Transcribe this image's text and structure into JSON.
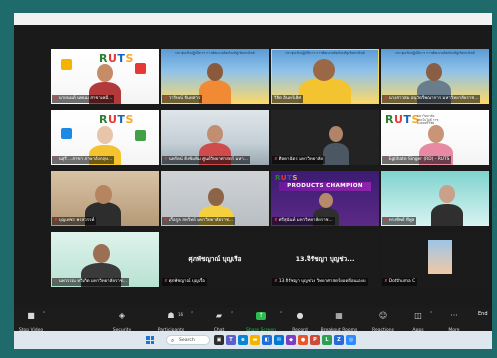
{
  "meeting": {
    "app": "Zoom",
    "tiles": [
      {
        "name": "นายนนท์ นพนม สาขาเคมี...",
        "row": 0,
        "col": 0,
        "bg": "bg-rut",
        "muted": true
      },
      {
        "name": "วาริษณ์ จันทสาร",
        "row": 0,
        "col": 1,
        "bg": "bg-banner",
        "muted": true
      },
      {
        "name": "วิจิต อินทร์เลิศ",
        "row": 0,
        "col": 2,
        "bg": "bg-banner",
        "muted": false,
        "active": true
      },
      {
        "name": "นางสาวสม อนุวัตรีพณาการ มหาวิทยาลัยราช...",
        "row": 0,
        "col": 3,
        "bg": "bg-banner",
        "muted": true
      },
      {
        "name": "นสุรี ...สาขา ภาษาอังกฤษ...",
        "row": 1,
        "col": 0,
        "bg": "bg-rut",
        "muted": true
      },
      {
        "name": "นพรัตน์ ดิ่งพิมพิม ศูนย์วิทยาศาสตร์ มหา...",
        "row": 1,
        "col": 1,
        "bg": "bg-office",
        "muted": true
      },
      {
        "name": "ศิลดาฉัตร มหาวิทยาลัย",
        "row": 1,
        "col": 2,
        "bg": "bg-dark",
        "muted": true
      },
      {
        "name": "Eglihate Singer (RD) - RUTS",
        "row": 1,
        "col": 3,
        "bg": "bg-rut",
        "muted": true
      },
      {
        "name": "บุญเพชร พรสวรรค์",
        "row": 2,
        "col": 0,
        "bg": "bg-wood",
        "muted": true
      },
      {
        "name": "เกื้อกูล สหวิทย์ มหาวิทยาลัยราช...",
        "row": 2,
        "col": 1,
        "bg": "bg-room",
        "muted": true
      },
      {
        "name": "ศรีสุนันท์ มหาวิทยาลัยราช...",
        "row": 2,
        "col": 2,
        "bg": "bg-purple",
        "muted": true
      },
      {
        "name": "ทรงทิพย์ ทีพูล",
        "row": 2,
        "col": 3,
        "bg": "bg-teal",
        "muted": true
      },
      {
        "name": "นพวรรณ ทวีเกิด มหาวิทยาลัยราช...",
        "row": 3,
        "col": 0,
        "bg": "bg-green",
        "muted": true
      },
      {
        "name": "ศุภพัชญาณ์ บุญเรือ",
        "row": 3,
        "col": 1,
        "bg": "bg-black",
        "muted": true,
        "placeholder": "ศุภพัชญาณ์ บุญเรือ"
      },
      {
        "name": "13.จิรัชญา บุญช่วง วิทยาศาสตร์ยอดยีอนเองบ",
        "row": 3,
        "col": 2,
        "bg": "bg-black",
        "muted": true,
        "placeholder": "13.จิรัชญา บุญช่ว..."
      },
      {
        "name": "Dotthuma C",
        "row": 3,
        "col": 3,
        "bg": "bg-black",
        "muted": true
      }
    ],
    "rut_logo": {
      "r": "R",
      "u": "U",
      "t": "T",
      "s": "S",
      "subtitle": "มหาวิทยาลัยเทคโนโลยี ราชมงคลศรีวิชัย"
    },
    "banner_title": "ประชุมเชิงปฏิบัติการ การพัฒนาผลิตภัณฑ์สู่เชิงพาณิชย์",
    "products_champion": "PRODUCTS CHAMPION"
  },
  "toolbar": {
    "items": [
      {
        "label": "Stop Video",
        "icon": "video-camera-icon"
      },
      {
        "label": "Security",
        "icon": "shield-icon"
      },
      {
        "label": "Participants",
        "icon": "participants-icon",
        "count": "16"
      },
      {
        "label": "Chat",
        "icon": "chat-icon"
      },
      {
        "label": "Share Screen",
        "icon": "share-screen-icon"
      },
      {
        "label": "Record",
        "icon": "record-icon"
      },
      {
        "label": "Breakout Rooms",
        "icon": "breakout-rooms-icon"
      },
      {
        "label": "Reactions",
        "icon": "reactions-icon"
      },
      {
        "label": "Apps",
        "icon": "apps-icon"
      },
      {
        "label": "More",
        "icon": "more-icon"
      }
    ],
    "end_label": "End"
  },
  "taskbar": {
    "search_placeholder": "Search"
  },
  "colors": {
    "frame": "#1f6b6c",
    "share_green": "#2ebc4f",
    "active_speaker": "#f2d94e",
    "mic_muted": "#e53935"
  }
}
